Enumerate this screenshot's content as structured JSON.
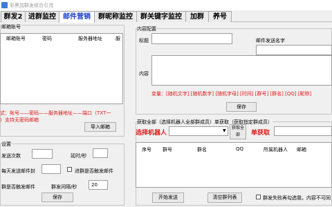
{
  "window": {
    "title": "彩黑加群发综合引流"
  },
  "tabs": [
    "群发2",
    "进群监控",
    "邮件营销",
    "群昵称监控",
    "群关键字监控",
    "加群",
    "养号"
  ],
  "left": {
    "account_group": "邮箱账号",
    "columns": [
      "邮箱账号",
      "密码",
      "服务器地址",
      "服"
    ],
    "format_hint_1": "式：账号——密码——服务器地址——端口（TXT一",
    "format_hint_2": "）支持无密码邮箱",
    "import_button": "导入邮箱"
  },
  "settings": {
    "group_title": "设置",
    "send_count_label": "发送次数",
    "send_count_value": "",
    "interval_label": "延时/秒",
    "interval_value": "",
    "daily_limit_label": "每天发送邮件封",
    "daily_limit_value": "",
    "trigger_label": "进群是否触发邮件",
    "send_trigger_label": "群是否触发邮件",
    "group_interval_label": "群发间隔/秒",
    "group_interval_value": "20",
    "save_button": "保存"
  },
  "content": {
    "group_title": "内容配置",
    "title_label": "标题",
    "title_value": "",
    "sender_label": "邮件发送名字",
    "sender_value": "",
    "content_label": "内容",
    "content_value": "",
    "variables": "变量：[随机文字] [随机数字] [随机字母] [时间] [群号] [群名] [QQ] [昵称]",
    "save_button": "保存"
  },
  "fetch": {
    "group_title": "获取全部（选择机器人全部群成员）单获取（获取指定群成员）",
    "robot_label": "选择机器人",
    "robot_value": "",
    "fetch_all_button": "获取全部",
    "single_label": "单获取",
    "single_value": "",
    "columns": [
      "序号",
      "群号",
      "群名",
      "QQ",
      "所属机器人",
      "邮箱"
    ],
    "start_button": "开始发送",
    "clear_button": "清空群列表",
    "failure_label": "群发失败再勾选我，内容不可同"
  },
  "colors": {
    "accent": "#1a3fd1",
    "alert": "#e01818"
  }
}
